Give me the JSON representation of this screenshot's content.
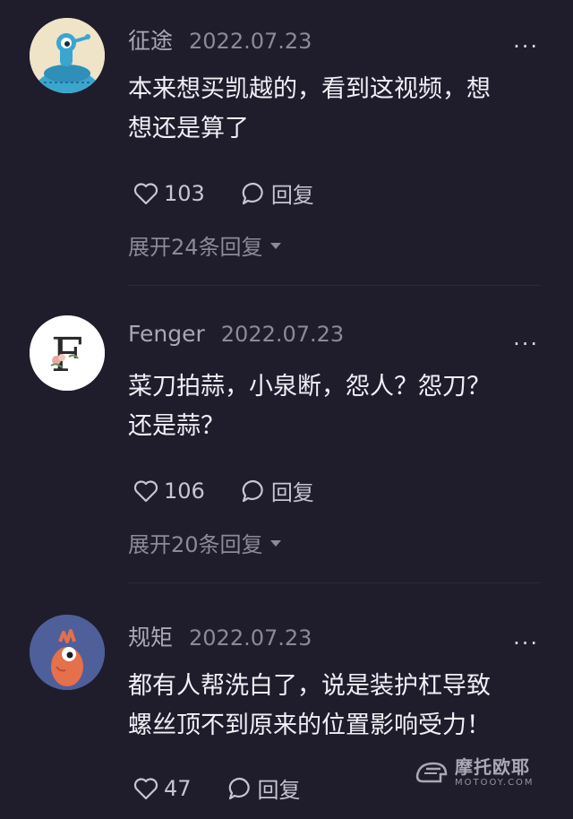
{
  "comments": [
    {
      "username": "征途",
      "date": "2022.07.23",
      "more": "···",
      "text_lines": [
        "本来想买凯越的，看到这视频，想",
        "想还是算了"
      ],
      "likes": "103",
      "reply_label": "回复",
      "expand_label": "展开24条回复",
      "avatar_icon": "cartoon-robot-avatar"
    },
    {
      "username": "Fenger",
      "date": "2022.07.23",
      "more": "···",
      "text_lines": [
        "菜刀拍蒜，小泉断，怨人？怨刀？",
        "还是蒜？"
      ],
      "likes": "106",
      "reply_label": "回复",
      "expand_label": "展开20条回复",
      "avatar_letter": "F",
      "avatar_icon": "floral-letter-avatar"
    },
    {
      "username": "规矩",
      "date": "2022.07.23",
      "more": "···",
      "text_lines": [
        "都有人帮洗白了，说是装护杠导致",
        "螺丝顶不到原来的位置影响受力！"
      ],
      "likes": "47",
      "reply_label": "回复",
      "avatar_icon": "cartoon-bird-avatar"
    }
  ],
  "watermark": {
    "main": "摩托欧耶",
    "sub": "MOTOOY.COM"
  },
  "colors": {
    "background": "#1f1d2b",
    "text": "#f1eff6",
    "muted": "#8c8999"
  }
}
